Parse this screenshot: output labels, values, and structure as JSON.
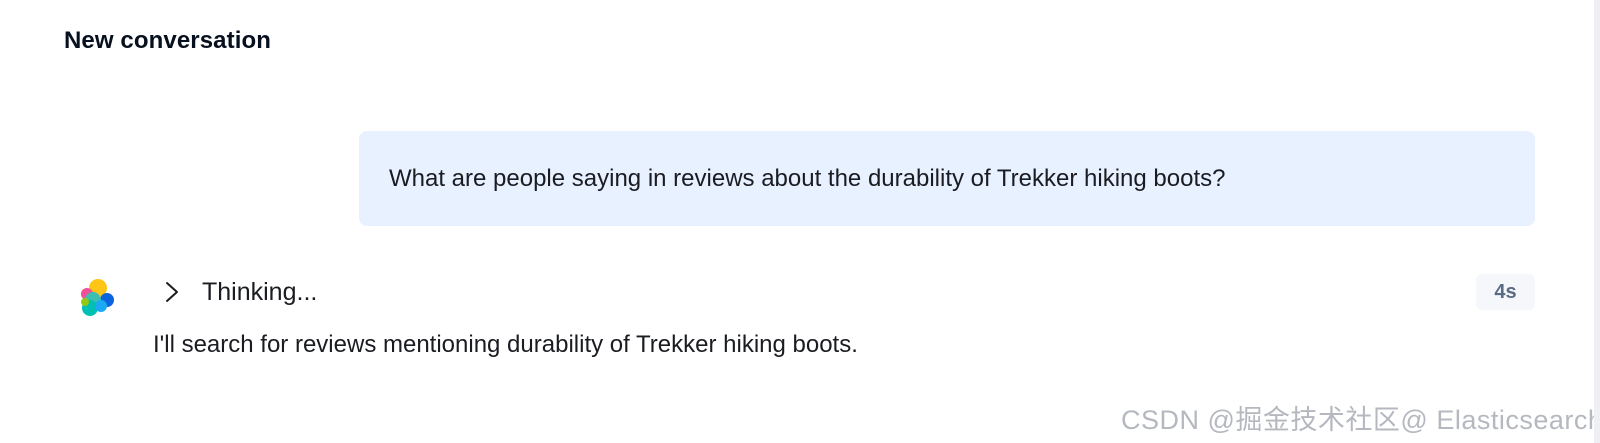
{
  "conversation": {
    "title": "New conversation"
  },
  "user_message": {
    "text": "What are people saying in reviews about the durability of Trekker hiking boots?"
  },
  "assistant": {
    "avatar_icon": "elastic-logo-icon",
    "thinking_label": "Thinking...",
    "thinking_toggle_icon": "chevron-right-icon",
    "duration": "4s",
    "message": "I'll search for reviews mentioning durability of Trekker hiking boots."
  },
  "watermark": {
    "text": "CSDN @掘金技术社区@ Elasticsearch"
  },
  "colors": {
    "user_bubble_bg": "#e8f1ff",
    "badge_bg": "#f5f7fa",
    "badge_text": "#5a6b85",
    "title_text": "#07101f",
    "body_text": "#1a1c21"
  }
}
